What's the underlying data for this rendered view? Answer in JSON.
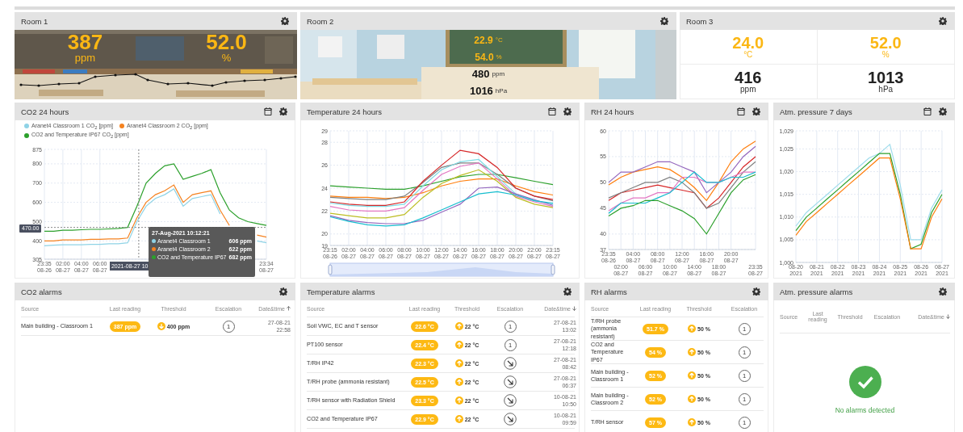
{
  "room_tiles": [
    {
      "title": "Room 1",
      "kind": "photo-overlay",
      "sparkline": true,
      "readings": [
        {
          "value": "387",
          "unit": "ppm",
          "alert": true
        },
        {
          "value": "52.0",
          "unit": "%",
          "alert": true
        }
      ]
    },
    {
      "title": "Room 2",
      "kind": "photo-list",
      "sparkline": false,
      "readings": [
        {
          "value": "22.9",
          "unit": "°C",
          "alert": true
        },
        {
          "value": "54.0",
          "unit": "%",
          "alert": true
        },
        {
          "value": "480",
          "unit": "ppm",
          "alert": false
        },
        {
          "value": "1016",
          "unit": "hPa",
          "alert": false
        }
      ]
    },
    {
      "title": "Room 3",
      "kind": "grid",
      "sparkline": false,
      "readings": [
        {
          "value": "24.0",
          "unit": "°C",
          "alert": true
        },
        {
          "value": "52.0",
          "unit": "%",
          "alert": true
        },
        {
          "value": "416",
          "unit": "ppm",
          "alert": false
        },
        {
          "value": "1013",
          "unit": "hPa",
          "alert": false
        }
      ]
    }
  ],
  "charts": [
    {
      "title": "CO2 24 hours",
      "date_picker": true,
      "navigator": false,
      "crosshair_date": "2021-08-27 10",
      "tooltip": {
        "title": "27-Aug-2021 10:12:21",
        "rows": [
          {
            "label": "Aranet4 Classroom 1",
            "value": "606 ppm",
            "color": "#8fd3e6"
          },
          {
            "label": "Aranet4 Classroom 2",
            "value": "622 ppm",
            "color": "#f58220"
          },
          {
            "label": "CO2 and Temperature IP67",
            "value": "682 ppm",
            "color": "#2ca02c"
          }
        ]
      },
      "chart_data": {
        "type": "line",
        "grid": true,
        "legend": "top",
        "ref_lines": [
          {
            "axis": "y",
            "value": 470,
            "label": "470.00"
          }
        ],
        "categories": [
          "23:35 08-26",
          null,
          "02:00 08-27",
          null,
          "04:00 08-27",
          null,
          "06:00 08-27",
          null,
          null,
          null,
          null,
          null,
          null,
          null,
          null,
          null,
          null,
          null,
          null,
          null,
          null,
          null,
          null,
          null,
          "23:34 08-27"
        ],
        "ylim": [
          305,
          875
        ],
        "yticks": [
          305,
          400,
          500,
          600,
          700,
          800,
          875
        ],
        "series": [
          {
            "name": "Aranet4 Classroom 1 CO$_{2}$ [ppm]",
            "color": "#8fd3e6",
            "values": [
              375,
              378,
              380,
              380,
              380,
              382,
              382,
              385,
              385,
              390,
              500,
              580,
              620,
              640,
              670,
              580,
              620,
              630,
              640,
              540,
              null,
              null,
              null,
              400,
              390
            ]
          },
          {
            "name": "Aranet4 Classroom 2 CO$_{2}$ [ppm]",
            "color": "#f58220",
            "values": [
              400,
              400,
              405,
              405,
              405,
              408,
              408,
              410,
              410,
              415,
              520,
              600,
              640,
              660,
              690,
              600,
              640,
              650,
              660,
              560,
              480,
              null,
              null,
              430,
              420
            ]
          },
          {
            "name": "CO2 and Temperature IP67 CO$_{2}$ [ppm]",
            "color": "#2ca02c",
            "values": [
              450,
              450,
              455,
              455,
              458,
              460,
              460,
              462,
              465,
              470,
              580,
              700,
              750,
              790,
              800,
              720,
              735,
              750,
              770,
              650,
              560,
              520,
              500,
              490,
              480
            ]
          }
        ]
      }
    },
    {
      "title": "Temperature 24 hours",
      "date_picker": true,
      "navigator": true,
      "chart_data": {
        "type": "line",
        "grid": true,
        "categories": [
          "23:15 08-26",
          "02:00 08-27",
          "04:00 08-27",
          "06:00 08-27",
          "08:00 08-27",
          "10:00 08-27",
          "12:00 08-27",
          "14:00 08-27",
          "16:00 08-27",
          "18:00 08-27",
          "20:00 08-27",
          "22:00 08-27",
          "23:15 08-27"
        ],
        "ylim": [
          19,
          29
        ],
        "yticks": [
          19,
          20,
          22,
          24,
          26,
          28,
          29
        ],
        "series": [
          {
            "color": "#2ca02c",
            "values": [
              24.2,
              24.1,
              24.0,
              23.9,
              23.9,
              24.2,
              24.6,
              25.0,
              25.2,
              25.2,
              24.9,
              24.6,
              24.3
            ]
          },
          {
            "color": "#ff7f0e",
            "values": [
              23.3,
              23.2,
              23.2,
              23.1,
              23.2,
              23.6,
              24.2,
              24.6,
              24.8,
              24.8,
              24.2,
              23.7,
              23.4
            ]
          },
          {
            "color": "#7f7f7f",
            "values": [
              23.2,
              23.1,
              23.0,
              23.0,
              23.3,
              24.5,
              25.8,
              26.2,
              26.2,
              25.2,
              24.0,
              23.3,
              22.9
            ]
          },
          {
            "color": "#d62728",
            "values": [
              22.8,
              22.6,
              22.5,
              22.5,
              22.8,
              24.6,
              26.0,
              27.3,
              27.0,
              25.8,
              24.0,
              23.3,
              23.0
            ]
          },
          {
            "color": "#7fdde6",
            "values": [
              22.7,
              22.5,
              22.4,
              22.4,
              22.6,
              24.2,
              25.6,
              26.3,
              26.5,
              25.0,
              23.5,
              22.9,
              22.6
            ]
          },
          {
            "color": "#e377c2",
            "values": [
              22.4,
              22.1,
              22.0,
              22.0,
              22.3,
              23.8,
              25.2,
              25.9,
              26.2,
              24.8,
              23.3,
              22.8,
              22.4
            ]
          },
          {
            "color": "#bcbd22",
            "values": [
              21.8,
              21.6,
              21.4,
              21.4,
              21.7,
              23.2,
              24.4,
              25.1,
              25.6,
              24.6,
              23.2,
              22.6,
              22.3
            ]
          },
          {
            "color": "#9467bd",
            "values": [
              21.6,
              21.2,
              21.0,
              20.9,
              20.9,
              21.2,
              21.9,
              22.6,
              24.0,
              24.1,
              23.5,
              23.0,
              22.5
            ]
          },
          {
            "color": "#17becf",
            "values": [
              21.5,
              21.1,
              20.8,
              20.7,
              20.8,
              21.4,
              22.1,
              22.8,
              23.5,
              23.7,
              23.4,
              22.9,
              22.7
            ]
          }
        ]
      }
    },
    {
      "title": "RH 24 hours",
      "date_picker": true,
      "navigator": false,
      "chart_data": {
        "type": "line",
        "grid": true,
        "categories": [
          "23:35 08-26",
          "02:00 08-27",
          "04:00 08-27",
          "06:00 08-27",
          "08:00 08-27",
          "10:00 08-27",
          "12:00 08-27",
          "14:00 08-27",
          "16:00 08-27",
          "18:00 08-27",
          "20:00 08-27",
          null,
          "23:35 08-27"
        ],
        "ylim": [
          37,
          60
        ],
        "yticks": [
          37,
          40,
          45,
          50,
          55,
          60
        ],
        "series": [
          {
            "color": "#ff7f0e",
            "values": [
              49.5,
              51,
              52,
              52.5,
              53,
              52.5,
              51,
              49,
              46.5,
              50,
              54,
              56.5,
              58
            ]
          },
          {
            "color": "#9467bd",
            "values": [
              50,
              52,
              52,
              53,
              54,
              54,
              53,
              52,
              48,
              50,
              52,
              55,
              57
            ]
          },
          {
            "color": "#d62728",
            "values": [
              46.5,
              48,
              48.5,
              49,
              49.5,
              49,
              48.5,
              48,
              45,
              47,
              50,
              53,
              55
            ]
          },
          {
            "color": "#7f7f7f",
            "values": [
              47,
              48,
              49,
              50,
              50,
              51,
              50,
              48,
              45,
              46,
              49,
              52,
              54
            ]
          },
          {
            "color": "#e377c2",
            "values": [
              44.5,
              46,
              47,
              47,
              48,
              48,
              51,
              51,
              50,
              50,
              51,
              52,
              52
            ]
          },
          {
            "color": "#17becf",
            "values": [
              44,
              46,
              46,
              46,
              47,
              48,
              50,
              52,
              50,
              50,
              51,
              51,
              52
            ]
          },
          {
            "color": "#2ca02c",
            "values": [
              43.5,
              45,
              45.5,
              46.5,
              46.5,
              45.5,
              44.5,
              43,
              40,
              44,
              48,
              50.5,
              51.5
            ]
          }
        ]
      }
    },
    {
      "title": "Atm. pressure 7 days",
      "date_picker": true,
      "navigator": false,
      "chart_data": {
        "type": "line",
        "grid": true,
        "categories": [
          "08-20 2021",
          null,
          "08-21 2021",
          null,
          "08-22 2021",
          null,
          "08-23 2021",
          null,
          "08-24 2021",
          null,
          "08-25 2021",
          null,
          "08-26 2021",
          null,
          "08-27 2021"
        ],
        "ylim": [
          1000,
          1029
        ],
        "yticks": [
          {
            "value": 1000,
            "label": "1,000"
          },
          {
            "value": 1005,
            "label": "1,005"
          },
          {
            "value": 1010,
            "label": "1,010"
          },
          {
            "value": 1015,
            "label": "1,015"
          },
          {
            "value": 1020,
            "label": "1,020"
          },
          {
            "value": 1025,
            "label": "1,025"
          },
          {
            "value": 1029,
            "label": "1,029"
          }
        ],
        "series": [
          {
            "color": "#9fdcec",
            "values": [
              1008,
              1011,
              1013,
              1015,
              1017,
              1019,
              1021,
              1023,
              1024,
              1026,
              1017,
              1005,
              1005,
              1012,
              1016
            ]
          },
          {
            "color": "#2ca02c",
            "values": [
              1007,
              1010,
              1012,
              1014,
              1016,
              1018,
              1020,
              1022,
              1024,
              1024,
              1015,
              1003,
              1004,
              1011,
              1015
            ]
          },
          {
            "color": "#ff7f0e",
            "values": [
              1006,
              1009,
              1011,
              1013,
              1015,
              1017,
              1019,
              1021,
              1023,
              1023,
              1014,
              1003,
              1003,
              1010,
              1014
            ]
          }
        ]
      }
    }
  ],
  "alarms": [
    {
      "title": "CO2 alarms",
      "columns": [
        {
          "label": "Source"
        },
        {
          "label": "Last reading"
        },
        {
          "label": "Threshold"
        },
        {
          "label": "Escalation"
        },
        {
          "label": "Date&time",
          "sort_ascending": true
        }
      ],
      "rows": [
        {
          "source": "Main building - Classroom 1",
          "reading": "387 ppm",
          "threshold": {
            "rising": false,
            "value": "400 ppm"
          },
          "escalation": {
            "kind": "number",
            "text": "1"
          },
          "date": "27-08-21",
          "time": "22:58"
        }
      ]
    },
    {
      "title": "Temperature alarms",
      "columns": [
        {
          "label": "Source"
        },
        {
          "label": "Last reading"
        },
        {
          "label": "Threshold"
        },
        {
          "label": "Escalation"
        },
        {
          "label": "Date&time",
          "sort_ascending": false
        }
      ],
      "rows": [
        {
          "source": "Soil VWC, EC and T sensor",
          "reading": "22.6 °C",
          "threshold": {
            "rising": true,
            "value": "22 °C"
          },
          "escalation": {
            "kind": "number",
            "text": "1"
          },
          "date": "27-08-21",
          "time": "13:02"
        },
        {
          "source": "PT100 sensor",
          "reading": "22.4 °C",
          "threshold": {
            "rising": true,
            "value": "22 °C"
          },
          "escalation": {
            "kind": "number",
            "text": "1"
          },
          "date": "27-08-21",
          "time": "12:18"
        },
        {
          "source": "T/RH IP42",
          "reading": "22.3 °C",
          "threshold": {
            "rising": true,
            "value": "22 °C"
          },
          "escalation": {
            "kind": "arrow"
          },
          "date": "27-08-21",
          "time": "08:42"
        },
        {
          "source": "T/RH probe (ammonia resistant)",
          "reading": "22.5 °C",
          "threshold": {
            "rising": true,
            "value": "22 °C"
          },
          "escalation": {
            "kind": "arrow"
          },
          "date": "27-08-21",
          "time": "06:37"
        },
        {
          "source": "T/RH sensor with Radiation Shield",
          "reading": "23.3 °C",
          "threshold": {
            "rising": true,
            "value": "22 °C"
          },
          "escalation": {
            "kind": "arrow"
          },
          "date": "10-08-21",
          "time": "10:50"
        },
        {
          "source": "CO2 and Temperature IP67",
          "reading": "22.9 °C",
          "threshold": {
            "rising": true,
            "value": "22 °C"
          },
          "escalation": {
            "kind": "arrow"
          },
          "date": "10-08-21",
          "time": "09:59"
        }
      ]
    },
    {
      "title": "RH alarms",
      "columns": [
        {
          "label": "Source"
        },
        {
          "label": "Last reading"
        },
        {
          "label": "Threshold"
        },
        {
          "label": "Escalation"
        }
      ],
      "rows": [
        {
          "source": "T/RH probe (ammonia resistant)",
          "reading": "51.7 %",
          "threshold": {
            "rising": true,
            "value": "50 %"
          },
          "escalation": {
            "kind": "number",
            "text": "1"
          }
        },
        {
          "source": "CO2 and Temperature IP67",
          "reading": "54 %",
          "threshold": {
            "rising": true,
            "value": "50 %"
          },
          "escalation": {
            "kind": "number",
            "text": "1"
          }
        },
        {
          "source": "Main building - Classroom 1",
          "reading": "52 %",
          "threshold": {
            "rising": true,
            "value": "50 %"
          },
          "escalation": {
            "kind": "number",
            "text": "1"
          }
        },
        {
          "source": "Main building - Classroom 2",
          "reading": "52 %",
          "threshold": {
            "rising": true,
            "value": "50 %"
          },
          "escalation": {
            "kind": "number",
            "text": "1"
          }
        },
        {
          "source": "T/RH sensor",
          "reading": "57 %",
          "threshold": {
            "rising": true,
            "value": "50 %"
          },
          "escalation": {
            "kind": "number",
            "text": "1"
          }
        }
      ]
    },
    {
      "title": "Atm. pressure alarms",
      "columns": [
        {
          "label": "Source"
        },
        {
          "label": "Last reading"
        },
        {
          "label": "Threshold"
        },
        {
          "label": "Escalation"
        },
        {
          "label": "Date&time",
          "sort_ascending": false
        }
      ],
      "empty_message": "No alarms detected"
    }
  ]
}
